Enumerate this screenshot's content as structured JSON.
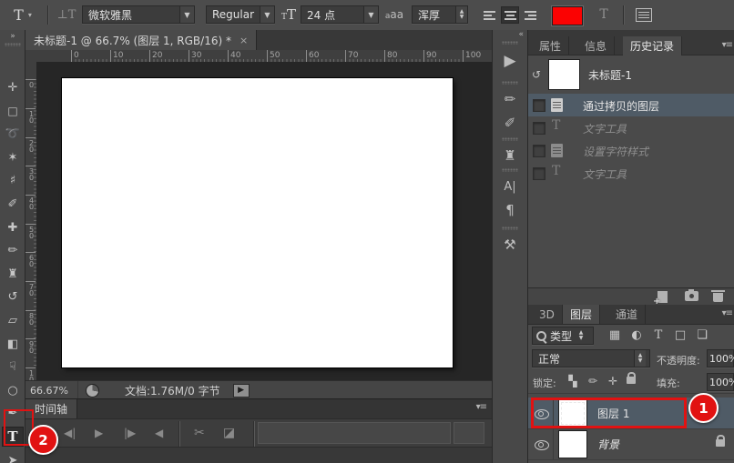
{
  "options_bar": {
    "type_tool": "T",
    "dropdown": "▾",
    "orientation_icon": "⊥T",
    "font_family": "微软雅黑",
    "font_style": "Regular",
    "size_icon": "T",
    "font_size": "24 点",
    "anti_alias_icon": "aa",
    "anti_alias": "浑厚",
    "swatch_color": "#fb0202",
    "warp_icon": "T",
    "align_names": [
      "align-left",
      "align-center",
      "align-right"
    ]
  },
  "doc_tab": {
    "title": "未标题-1 @ 66.7% (图层 1, RGB/16) *",
    "close": "×"
  },
  "rulers": {
    "h": [
      "0",
      "10",
      "20",
      "30",
      "40",
      "50",
      "60",
      "70",
      "80",
      "90",
      "100"
    ],
    "v": [
      "0",
      "10",
      "20",
      "30",
      "40",
      "50",
      "60",
      "70",
      "80",
      "90",
      "100"
    ]
  },
  "toolbar": {
    "collapse": "»",
    "tools": [
      {
        "name": "move",
        "glyph": "✛"
      },
      {
        "name": "marquee",
        "glyph": "□"
      },
      {
        "name": "lasso",
        "glyph": "➰"
      },
      {
        "name": "magic-wand",
        "glyph": "✶"
      },
      {
        "name": "crop",
        "glyph": "♯"
      },
      {
        "name": "eyedropper",
        "glyph": "✐"
      },
      {
        "name": "healing-brush",
        "glyph": "✚"
      },
      {
        "name": "brush",
        "glyph": "✏"
      },
      {
        "name": "clone-stamp",
        "glyph": "♜"
      },
      {
        "name": "history-brush",
        "glyph": "↺"
      },
      {
        "name": "eraser",
        "glyph": "▱"
      },
      {
        "name": "gradient",
        "glyph": "◧"
      },
      {
        "name": "smudge",
        "glyph": "☟"
      },
      {
        "name": "dodge",
        "glyph": "○"
      },
      {
        "name": "pen",
        "glyph": "✒"
      },
      {
        "name": "type",
        "glyph": "T"
      },
      {
        "name": "path-selection",
        "glyph": "➤"
      }
    ]
  },
  "dock": {
    "collapse": "«",
    "icons": [
      {
        "name": "actions",
        "glyph": "▶"
      },
      {
        "name": "brush-presets",
        "glyph": "✏"
      },
      {
        "name": "brushes",
        "glyph": "✐"
      },
      {
        "name": "clone-source",
        "glyph": "♜"
      },
      {
        "name": "character",
        "glyph": "A|"
      },
      {
        "name": "paragraph",
        "glyph": "¶"
      },
      {
        "name": "tool-presets",
        "glyph": "⚒"
      }
    ]
  },
  "status_bar": {
    "zoom": "66.67%",
    "doc_info": "文档:1.76M/0 字节",
    "expand": "▶"
  },
  "timeline": {
    "tab": "时间轴",
    "menu": "▾≡",
    "controls": [
      {
        "name": "go-to-first-frame",
        "glyph": "◀|"
      },
      {
        "name": "play",
        "glyph": "▶"
      },
      {
        "name": "go-to-next-frame",
        "glyph": "|▶"
      },
      {
        "name": "audio",
        "glyph": "◀"
      }
    ],
    "scissors": "✂",
    "transition": "◪"
  },
  "history": {
    "tabs": [
      "属性",
      "信息",
      "历史记录"
    ],
    "menu": "▾≡",
    "snapshot_brush": "↺",
    "snapshot": "未标题-1",
    "states": [
      {
        "label": "通过拷贝的图层"
      },
      {
        "label": "文字工具"
      },
      {
        "label": "设置字符样式"
      },
      {
        "label": "文字工具"
      }
    ]
  },
  "layers": {
    "tabs": [
      "3D",
      "图层",
      "通道"
    ],
    "menu": "▾≡",
    "filter_label": "类型",
    "filter_icons": [
      {
        "name": "pixel-layer-filter",
        "glyph": "▦"
      },
      {
        "name": "adjustment-layer-filter",
        "glyph": "◐"
      },
      {
        "name": "type-layer-filter",
        "glyph": "T"
      },
      {
        "name": "shape-layer-filter",
        "glyph": "□"
      },
      {
        "name": "smart-object-filter",
        "glyph": "❏"
      }
    ],
    "blend_mode": "正常",
    "opacity_label": "不透明度:",
    "opacity": "100%",
    "lock_label": "锁定:",
    "lock_icons": [
      {
        "name": "lock-transparent-pixels",
        "glyph": "▚"
      },
      {
        "name": "lock-image-pixels",
        "glyph": "✏"
      },
      {
        "name": "lock-position",
        "glyph": "✛"
      }
    ],
    "fill_label": "填充:",
    "fill": "100%",
    "rows": [
      {
        "name": "图层 1"
      },
      {
        "name": "背景"
      }
    ]
  },
  "annotations": {
    "color": "#e11212",
    "step1": "1",
    "step2": "2"
  }
}
